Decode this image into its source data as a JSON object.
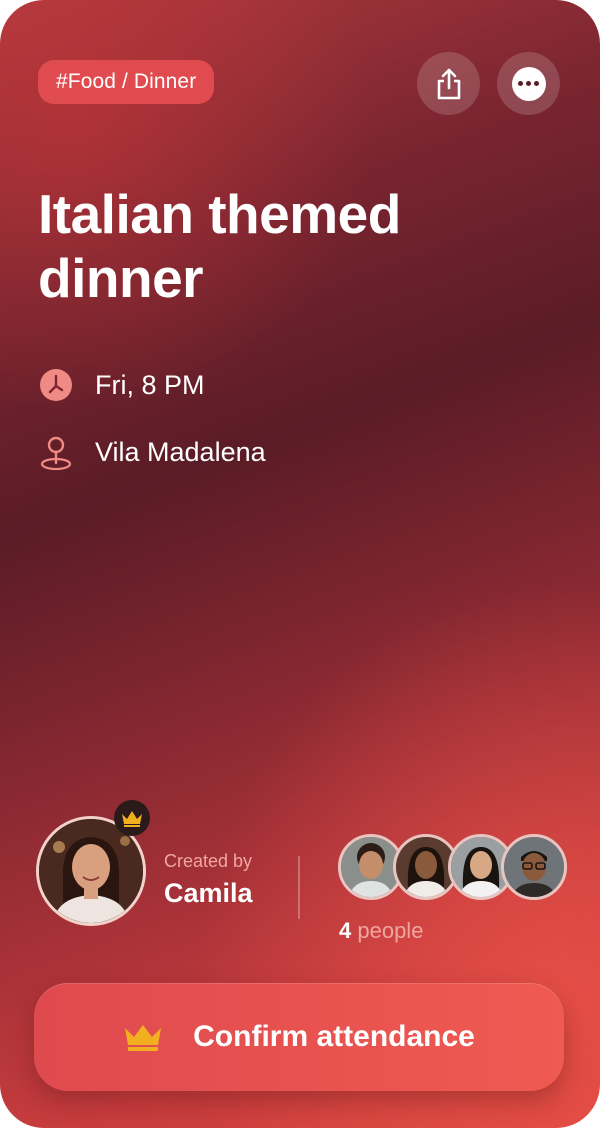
{
  "event": {
    "tag": "#Food / Dinner",
    "title": "Italian themed dinner",
    "time": "Fri, 8 PM",
    "location": "Vila Madalena"
  },
  "creator": {
    "label": "Created by",
    "name": "Camila"
  },
  "attendees": {
    "count": "4",
    "suffix": " people",
    "avatars": [
      "attendee-1",
      "attendee-2",
      "attendee-3",
      "attendee-4"
    ]
  },
  "actions": {
    "confirm_label": "Confirm attendance",
    "share_icon": "share-icon",
    "more_icon": "more-icon"
  },
  "colors": {
    "accent": "#e04b50",
    "button": "#ef5a52",
    "crown": "#f2b01e"
  }
}
